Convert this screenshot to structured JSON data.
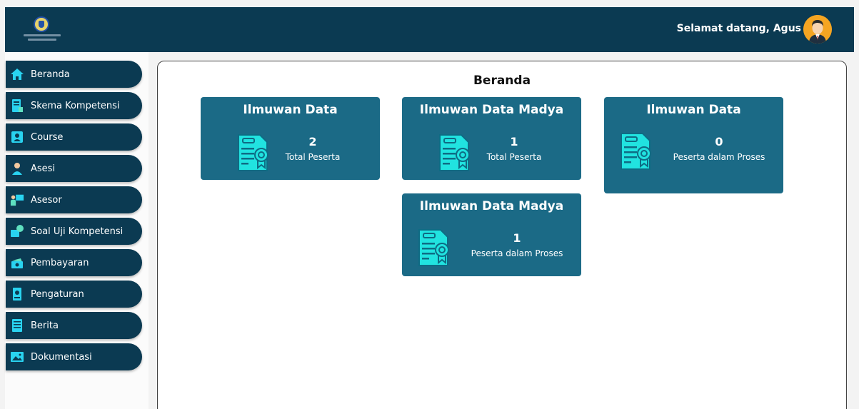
{
  "header": {
    "welcome_text": "Selamat datang, Agus",
    "background": "#0b3a52"
  },
  "sidebar": {
    "items": [
      {
        "label": "Beranda",
        "icon": "home-icon"
      },
      {
        "label": "Skema Kompetensi",
        "icon": "book-icon"
      },
      {
        "label": "Course",
        "icon": "course-icon"
      },
      {
        "label": "Asesi",
        "icon": "user-icon"
      },
      {
        "label": "Asesor",
        "icon": "presenter-icon"
      },
      {
        "label": "Soal Uji Kompetensi",
        "icon": "quiz-icon"
      },
      {
        "label": "Pembayaran",
        "icon": "money-icon"
      },
      {
        "label": "Pengaturan",
        "icon": "settings-icon"
      },
      {
        "label": "Berita",
        "icon": "news-icon"
      },
      {
        "label": "Dokumentasi",
        "icon": "image-icon"
      }
    ]
  },
  "main": {
    "title": "Beranda",
    "cards": [
      {
        "title": "Ilmuwan Data",
        "value": "2",
        "label": "Total Peserta",
        "icon": "certificate-icon"
      },
      {
        "title": "Ilmuwan Data Madya",
        "value": "1",
        "label": "Total Peserta",
        "icon": "certificate-icon"
      },
      {
        "title": "Ilmuwan Data",
        "value": "0",
        "label": "Peserta dalam Proses",
        "icon": "certificate-icon"
      },
      {
        "title": "Ilmuwan Data Madya",
        "value": "1",
        "label": "Peserta dalam Proses",
        "icon": "certificate-icon"
      }
    ]
  },
  "colors": {
    "accent": "#1b6a86",
    "icon_accent": "#21e3e0",
    "sidebar_item": "#0b3a52"
  }
}
